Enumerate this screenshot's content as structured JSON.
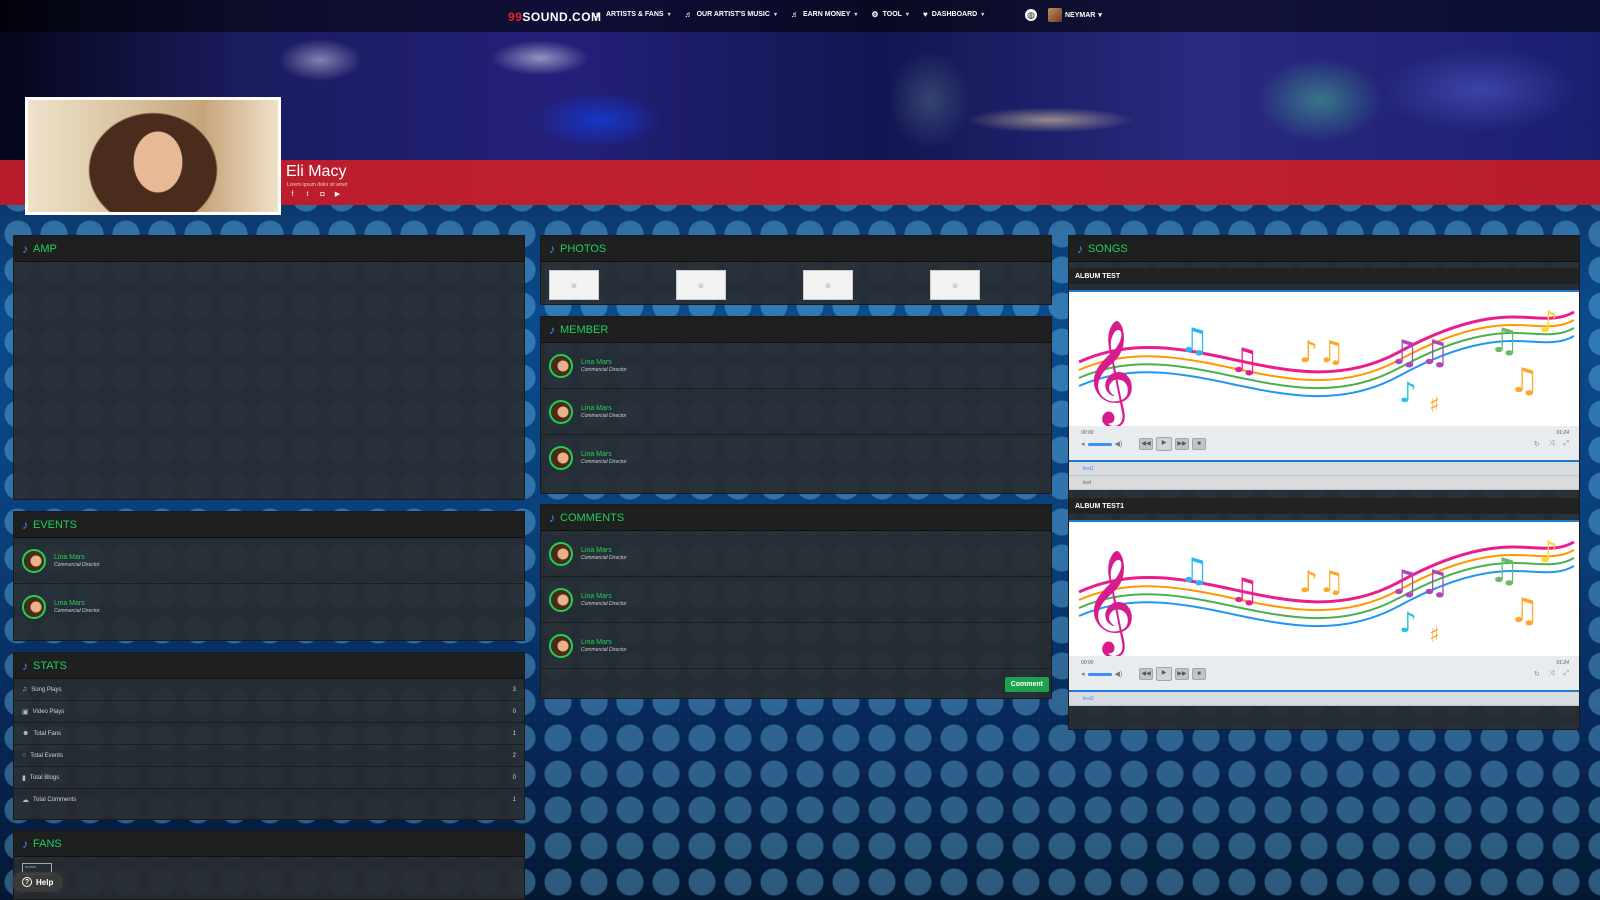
{
  "nav": {
    "logo_num": "99",
    "logo_text": "SOUND.COM",
    "items": [
      {
        "label": "ARTISTS & FANS",
        "icon": "music-note-icon"
      },
      {
        "label": "OUR ARTIST'S MUSIC",
        "icon": "music-note-icon"
      },
      {
        "label": "EARN MONEY",
        "icon": "music-note-icon"
      },
      {
        "label": "TOOL",
        "icon": "tool-icon"
      },
      {
        "label": "DASHBOARD",
        "icon": "heart-icon"
      }
    ],
    "user": "NEYMAR"
  },
  "profile": {
    "name": "Eli Macy",
    "subtitle": "Lorem ipsum dolor sit amet"
  },
  "panels": {
    "amp": "AMP",
    "events": "EVENTS",
    "stats": "STATS",
    "fans": "FANS",
    "photos": "PHOTOS",
    "member": "MEMBER",
    "comments": "COMMENTS",
    "songs": "SONGS"
  },
  "events": [
    {
      "name": "Lina Mars",
      "role": "Commercial Director"
    },
    {
      "name": "Lina Mars",
      "role": "Commercial Director"
    }
  ],
  "members": [
    {
      "name": "Lina Mars",
      "role": "Commercial Director"
    },
    {
      "name": "Lina Mars",
      "role": "Commercial Director"
    },
    {
      "name": "Lina Mars",
      "role": "Commercial Director"
    }
  ],
  "comments": [
    {
      "name": "Lina Mars",
      "role": "Commercial Director"
    },
    {
      "name": "Lina Mars",
      "role": "Commercial Director"
    },
    {
      "name": "Lina Mars",
      "role": "Commercial Director"
    }
  ],
  "comment_button": "Comment",
  "stats": [
    {
      "label": "Song Plays",
      "value": "3",
      "icon": "music-note-icon"
    },
    {
      "label": "Video Plays",
      "value": "0",
      "icon": "video-icon"
    },
    {
      "label": "Total Fans",
      "value": "1",
      "icon": "users-icon"
    },
    {
      "label": "Total Events",
      "value": "2",
      "icon": "event-icon"
    },
    {
      "label": "Total Blogs",
      "value": "0",
      "icon": "bookmark-icon"
    },
    {
      "label": "Total Comments",
      "value": "1",
      "icon": "comments-icon"
    }
  ],
  "albums": [
    {
      "title": "ALBUM TEST",
      "time_start": "00:00",
      "time_end": "01:24",
      "tracks": [
        "test1",
        "test"
      ]
    },
    {
      "title": "ALBUM TEST1",
      "time_start": "00:00",
      "time_end": "01:24",
      "tracks": [
        "test2"
      ]
    }
  ],
  "fans_img_alt": "avatar",
  "help": "Help",
  "colors": {
    "accent_green": "#1fd157",
    "accent_blue": "#3d8cff",
    "banner_red": "#c3202f"
  }
}
